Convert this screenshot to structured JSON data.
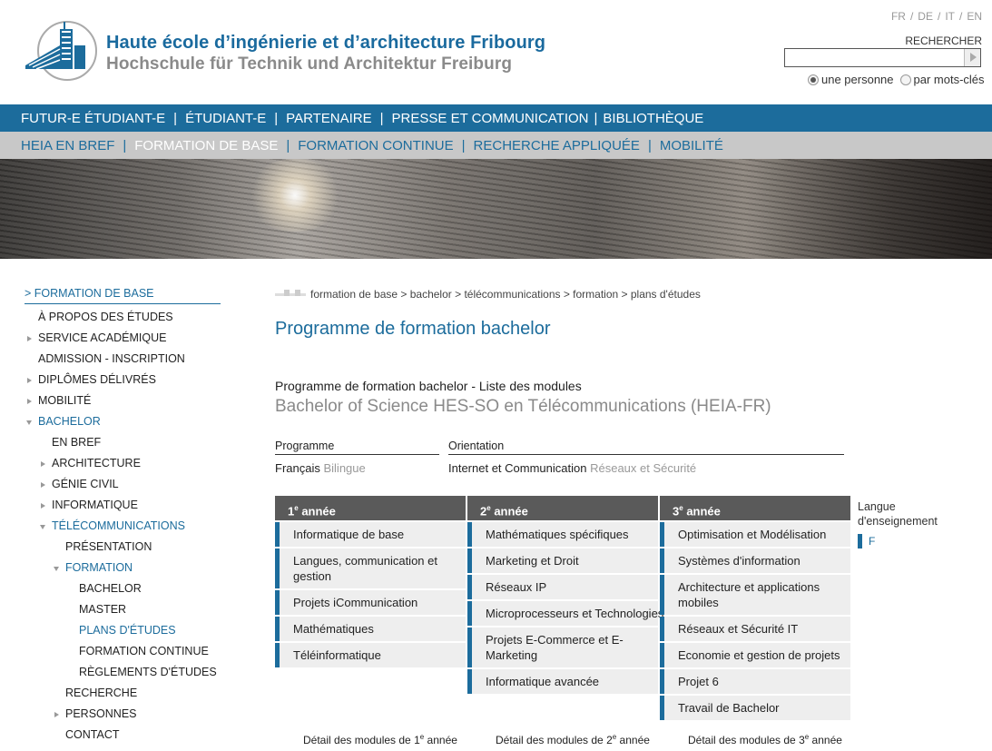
{
  "header": {
    "title_fr": "Haute école d’ingénierie et d’architecture Fribourg",
    "title_de": "Hochschule für Technik und Architektur Freiburg",
    "languages": [
      "FR",
      "DE",
      "IT",
      "EN"
    ],
    "search_label": "RECHERCHER",
    "search_value": "",
    "radio_person": "une personne",
    "radio_keywords": "par mots-clés"
  },
  "nav_primary": [
    "FUTUR-E ÉTUDIANT-E",
    "ÉTUDIANT-E",
    "PARTENAIRE",
    "PRESSE ET COMMUNICATION",
    "BIBLIOTHÈQUE"
  ],
  "nav_secondary": [
    "HEIA EN BREF",
    "FORMATION DE BASE",
    "FORMATION CONTINUE",
    "RECHERCHE APPLIQUÉE",
    "MOBILITÉ"
  ],
  "sidebar": {
    "heading": "> FORMATION DE BASE",
    "items": [
      "À PROPOS DES ÉTUDES",
      "SERVICE ACADÉMIQUE",
      "ADMISSION - INSCRIPTION",
      "DIPLÔMES DÉLIVRÉS",
      "MOBILITÉ",
      "BACHELOR",
      "EN BREF",
      "ARCHITECTURE",
      "GÉNIE CIVIL",
      "INFORMATIQUE",
      "TÉLÉCOMMUNICATIONS",
      "PRÉSENTATION",
      "FORMATION",
      "BACHELOR",
      "MASTER",
      "PLANS D'ÉTUDES",
      "FORMATION CONTINUE",
      "RÈGLEMENTS D'ÉTUDES",
      "RECHERCHE",
      "PERSONNES",
      "CONTACT"
    ]
  },
  "breadcrumb": "formation de base > bachelor > télécommunications > formation > plans d'études",
  "main": {
    "title": "Programme de formation bachelor",
    "subtitle": "Programme de formation bachelor - Liste des modules",
    "degree": "Bachelor of Science HES-SO en Télécommunications (HEIA-FR)",
    "programme_label": "Programme",
    "programme_value": "Français",
    "programme_muted": "Bilingue",
    "orientation_label": "Orientation",
    "orientation_value": "Internet et Communication",
    "orientation_muted": "Réseaux et Sécurité",
    "lang_heading": "Langue d'enseignement",
    "lang_value": "F"
  },
  "years": [
    {
      "num": "1",
      "sup": "e",
      "label": "année",
      "modules": [
        "Informatique de base",
        "Langues, communication et gestion",
        "Projets iCommunication",
        "Mathématiques",
        "Téléinformatique"
      ],
      "detail_prefix": "Détail des modules de 1",
      "detail_sup": "e",
      "detail_suffix": "année"
    },
    {
      "num": "2",
      "sup": "e",
      "label": "année",
      "modules": [
        "Mathématiques spécifiques",
        "Marketing et Droit",
        "Réseaux IP",
        "Microprocesseurs et Technologies",
        "Projets E-Commerce et E-Marketing",
        "Informatique avancée"
      ],
      "detail_prefix": "Détail des modules de 2",
      "detail_sup": "e",
      "detail_suffix": "année"
    },
    {
      "num": "3",
      "sup": "e",
      "label": "année",
      "modules": [
        "Optimisation et Modélisation",
        "Systèmes d'information",
        "Architecture et applications mobiles",
        "Réseaux et Sécurité IT",
        "Economie et gestion de projets",
        "Projet 6",
        "Travail de Bachelor"
      ],
      "detail_prefix": "Détail des modules de 3",
      "detail_sup": "e",
      "detail_suffix": "année"
    }
  ],
  "colors": {
    "brand_blue": "#1c6c9c",
    "nav_grey": "#c8c8c8",
    "column_head": "#5a5a5a",
    "module_bg": "#eeeeee"
  }
}
